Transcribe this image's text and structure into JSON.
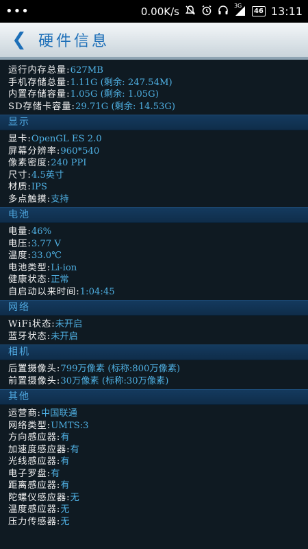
{
  "status": {
    "left": "•••",
    "speed": "0.00K/s",
    "signal": "3G",
    "battery": "46",
    "time": "13:11",
    "icons": [
      "silent-bell-icon",
      "alarm-icon",
      "headset-icon",
      "signal-icon",
      "battery-icon"
    ]
  },
  "header": {
    "back_icon": "back-chevron-icon",
    "title": "硬件信息"
  },
  "sections": [
    {
      "title": "",
      "rows": [
        {
          "label": "运行内存总量:",
          "value": "627MB"
        },
        {
          "label": "手机存储总量:",
          "value": "1.11G (剩余: 247.54M)"
        },
        {
          "label": "内置存储容量:",
          "value": "1.05G (剩余: 1.05G)"
        },
        {
          "label": "SD存储卡容量:",
          "value": "29.71G (剩余: 14.53G)"
        }
      ]
    },
    {
      "title": "显示",
      "rows": [
        {
          "label": "显卡:",
          "value": "OpenGL ES 2.0"
        },
        {
          "label": "屏幕分辨率:",
          "value": "960*540"
        },
        {
          "label": "像素密度:",
          "value": "240 PPI"
        },
        {
          "label": "尺寸:",
          "value": "4.5英寸"
        },
        {
          "label": "材质:",
          "value": "IPS"
        },
        {
          "label": "多点触摸:",
          "value": "支持"
        }
      ]
    },
    {
      "title": "电池",
      "rows": [
        {
          "label": "电量:",
          "value": "46%"
        },
        {
          "label": "电压:",
          "value": "3.77 V"
        },
        {
          "label": "温度:",
          "value": "33.0℃"
        },
        {
          "label": "电池类型:",
          "value": "Li-ion"
        },
        {
          "label": "健康状态:",
          "value": "正常"
        },
        {
          "label": "自启动以来时间:",
          "value": "1:04:45"
        }
      ]
    },
    {
      "title": "网络",
      "rows": [
        {
          "label": "WiFi状态:",
          "value": "未开启"
        },
        {
          "label": "蓝牙状态:",
          "value": "未开启"
        }
      ]
    },
    {
      "title": "相机",
      "rows": [
        {
          "label": "后置摄像头:",
          "value": "799万像素 (标称:800万像素)"
        },
        {
          "label": "前置摄像头:",
          "value": "30万像素 (标称:30万像素)"
        }
      ]
    },
    {
      "title": "其他",
      "rows": [
        {
          "label": "运营商:",
          "value": "中国联通"
        },
        {
          "label": "网络类型:",
          "value": "UMTS:3"
        },
        {
          "label": "方向感应器:",
          "value": "有"
        },
        {
          "label": "加速度感应器:",
          "value": "有"
        },
        {
          "label": "光线感应器:",
          "value": "有"
        },
        {
          "label": "电子罗盘:",
          "value": "有"
        },
        {
          "label": "距离感应器:",
          "value": "有"
        },
        {
          "label": "陀螺仪感应器:",
          "value": "无"
        },
        {
          "label": "温度感应器:",
          "value": "无"
        },
        {
          "label": "压力传感器:",
          "value": "无"
        }
      ]
    }
  ]
}
